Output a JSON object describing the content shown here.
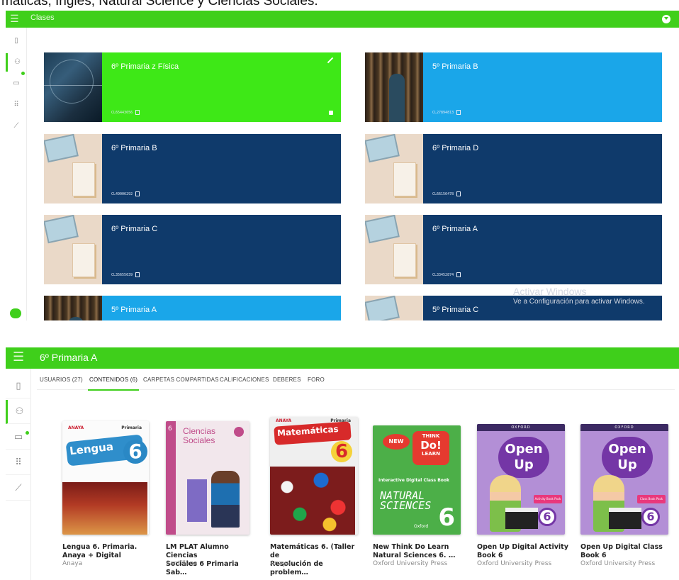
{
  "caption": "máticas, Inglés, Natural Science y Ciencias Sociales.",
  "panel1": {
    "title": "Clases",
    "classes": [
      {
        "name": "6º Primaria z Física",
        "code": "CL65443656"
      },
      {
        "name": "5º Primaria B",
        "code": "CL27894813"
      },
      {
        "name": "6º Primaria B",
        "code": "CL49006292"
      },
      {
        "name": "6º Primaria D",
        "code": "CL66156478"
      },
      {
        "name": "6º Primaria C",
        "code": "CL35655639"
      },
      {
        "name": "6º Primaria A",
        "code": "CL33452874"
      },
      {
        "name": "5º Primaria A",
        "code": ""
      },
      {
        "name": "5º Primaria C",
        "code": ""
      }
    ],
    "watermark": {
      "line1": "Activar Windows",
      "line2": "Ve a Configuración para activar Windows."
    },
    "colors": {
      "green": "#3ee817",
      "navy": "#0f3a6b",
      "blue": "#1aa6e9",
      "bar": "#3fcf1b"
    }
  },
  "panel2": {
    "title": "6º Primaria A",
    "tabs": [
      {
        "label": "USUARIOS (27)",
        "active": false
      },
      {
        "label": "CONTENIDOS (6)",
        "active": true
      },
      {
        "label": "CARPETAS COMPARTIDAS",
        "active": false
      },
      {
        "label": "CALIFICACIONES",
        "active": false
      },
      {
        "label": "DEBERES",
        "active": false
      },
      {
        "label": "FORO",
        "active": false
      }
    ],
    "books": [
      {
        "title_line1": "Lengua 6. Primaria.",
        "title_line2": "Anaya + Digital",
        "publisher": "Anaya",
        "cover": {
          "brand": "ANAYA",
          "level": "Primaria",
          "word": "Lengua",
          "num": "6"
        }
      },
      {
        "title_line1": "LM PLAT Alumno Ciencias",
        "title_line2": "Sociales 6 Primaria Sab…",
        "publisher": "Santillana",
        "cover": {
          "num": "6",
          "line1": "Ciencias",
          "line2": "Sociales"
        }
      },
      {
        "title_line1": "Matemáticas 6. (Taller de",
        "title_line2": "Resolución de problem…",
        "publisher": "Anaya",
        "cover": {
          "brand": "ANAYA",
          "level": "Primaria",
          "word": "Matemáticas",
          "num": "6"
        }
      },
      {
        "title_line1": "New Think Do Learn",
        "title_line2": "Natural Sciences 6. …",
        "publisher": "Oxford University Press",
        "cover": {
          "new": "NEW",
          "think": "THINK",
          "do": "Do!",
          "learn": "LEARN",
          "sub": "Interactive Digital Class Book",
          "big1": "NATURAL",
          "big2": "SCIENCES",
          "num": "6",
          "brand": "Oxford"
        }
      },
      {
        "title_line1": "Open Up Digital Activity",
        "title_line2": "Book 6",
        "publisher": "Oxford University Press",
        "cover": {
          "head": "OXFORD",
          "logo1": "Open",
          "logo2": "Up",
          "badge": "Activity Book Pack",
          "num": "6"
        }
      },
      {
        "title_line1": "Open Up Digital Class",
        "title_line2": "Book 6",
        "publisher": "Oxford University Press",
        "cover": {
          "head": "OXFORD",
          "logo1": "Open",
          "logo2": "Up",
          "badge": "Class Book Pack",
          "num": "6"
        }
      }
    ]
  }
}
